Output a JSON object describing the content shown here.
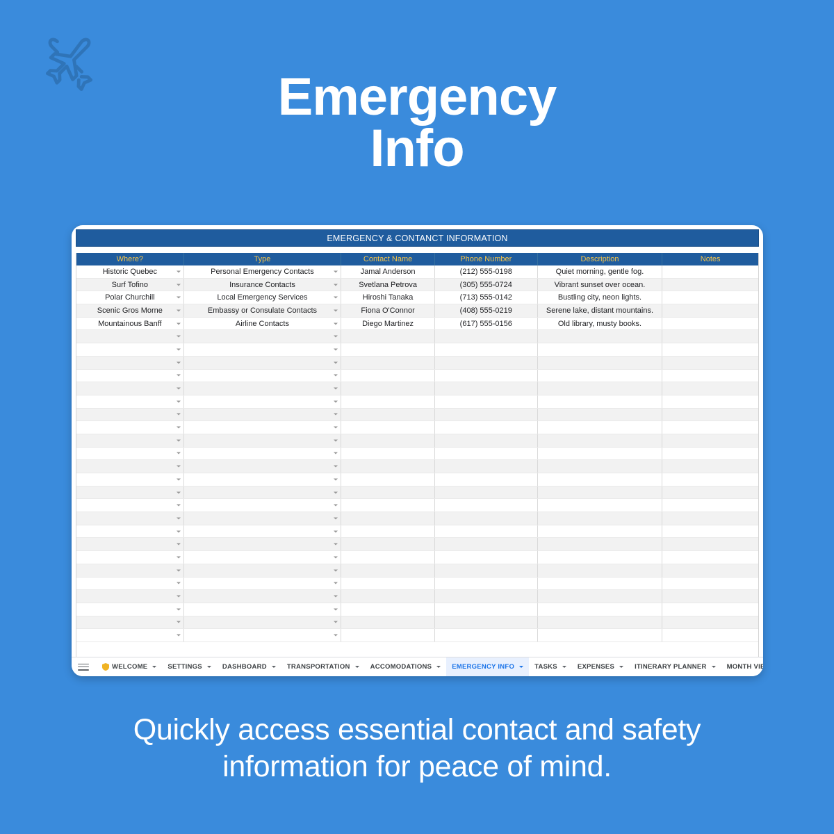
{
  "page": {
    "background_color": "#3a8bdc",
    "logo_icon": "crossed-airplanes-icon",
    "headline_line1": "Emergency",
    "headline_line2": "Info",
    "caption_line1": "Quickly access essential contact and safety",
    "caption_line2": "information for peace of mind."
  },
  "spreadsheet": {
    "banner_title": "EMERGENCY & CONTANCT INFORMATION",
    "header_bg": "#1f5c9e",
    "header_text_color": "#f5c44a",
    "columns": [
      "Where?",
      "Type",
      "Contact Name",
      "Phone Number",
      "Description",
      "Notes"
    ],
    "rows": [
      {
        "where": "Historic Quebec",
        "type": "Personal Emergency Contacts",
        "contact_name": "Jamal Anderson",
        "phone_number": "(212) 555-0198",
        "description": "Quiet morning, gentle fog.",
        "notes": ""
      },
      {
        "where": "Surf Tofino",
        "type": "Insurance Contacts",
        "contact_name": "Svetlana Petrova",
        "phone_number": "(305) 555-0724",
        "description": "Vibrant sunset over ocean.",
        "notes": ""
      },
      {
        "where": "Polar Churchill",
        "type": "Local Emergency Services",
        "contact_name": "Hiroshi Tanaka",
        "phone_number": "(713) 555-0142",
        "description": "Bustling city, neon lights.",
        "notes": ""
      },
      {
        "where": "Scenic Gros Morne",
        "type": "Embassy or Consulate Contacts",
        "contact_name": "Fiona O'Connor",
        "phone_number": "(408) 555-0219",
        "description": "Serene lake, distant mountains.",
        "notes": ""
      },
      {
        "where": "Mountainous Banff",
        "type": "Airline Contacts",
        "contact_name": "Diego Martinez",
        "phone_number": "(617) 555-0156",
        "description": "Old library, musty books.",
        "notes": ""
      }
    ],
    "empty_row_count": 24
  },
  "tabbar": {
    "menu_icon": "hamburger-menu-icon",
    "active_tab": "EMERGENCY INFO",
    "active_tab_color": "#1a73e8",
    "active_tab_bg": "#e8f0fe",
    "tabs": [
      {
        "label": "WELCOME",
        "icon": "shield-icon",
        "active": false
      },
      {
        "label": "SETTINGS",
        "icon": "",
        "active": false
      },
      {
        "label": "DASHBOARD",
        "icon": "",
        "active": false
      },
      {
        "label": "TRANSPORTATION",
        "icon": "",
        "active": false
      },
      {
        "label": "ACCOMODATIONS",
        "icon": "",
        "active": false
      },
      {
        "label": "EMERGENCY INFO",
        "icon": "",
        "active": true
      },
      {
        "label": "TASKS",
        "icon": "",
        "active": false
      },
      {
        "label": "EXPENSES",
        "icon": "",
        "active": false
      },
      {
        "label": "ITINERARY PLANNER",
        "icon": "",
        "active": false
      },
      {
        "label": "MONTH VIEW",
        "icon": "",
        "active": false
      }
    ]
  }
}
